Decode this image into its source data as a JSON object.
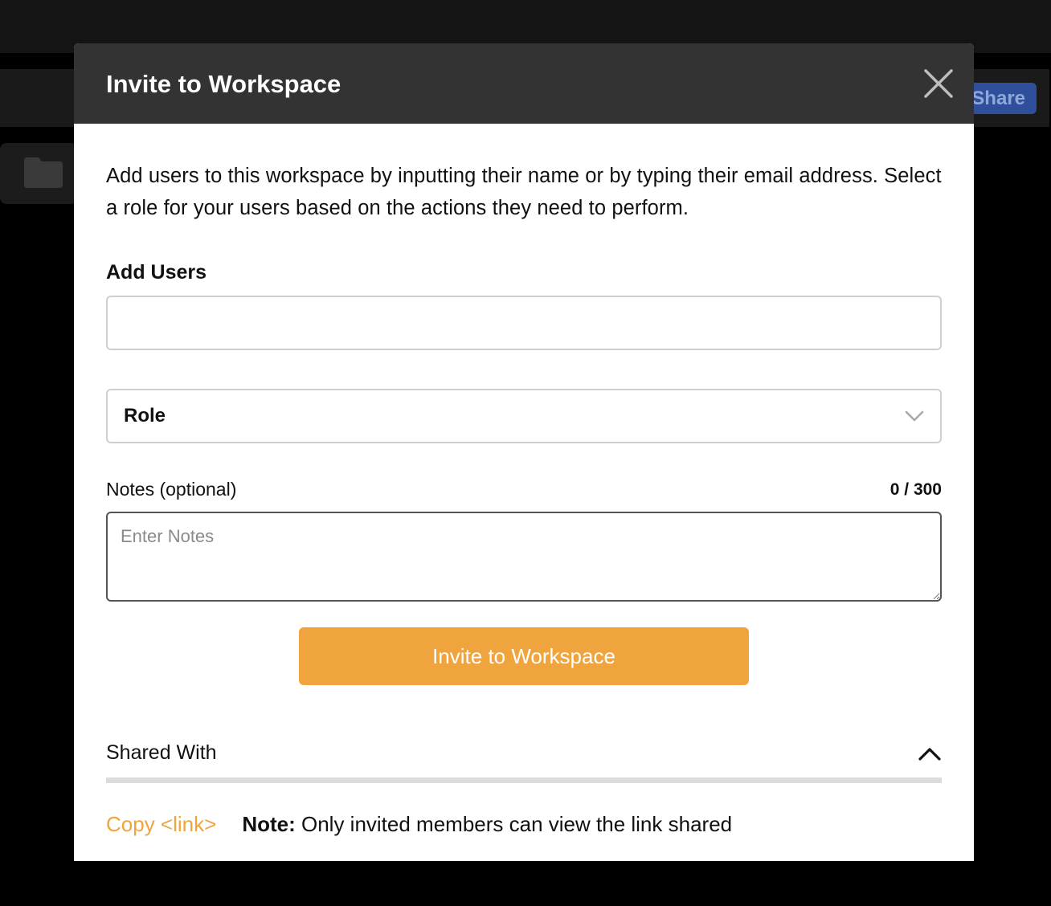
{
  "background": {
    "share_label": "Share"
  },
  "modal": {
    "title": "Invite to Workspace",
    "description": "Add users to this workspace by inputting their name or by typing their email address. Select a role for your users based on the actions they need to perform.",
    "add_users": {
      "label": "Add Users",
      "value": "",
      "placeholder": ""
    },
    "role": {
      "selected": "Role"
    },
    "notes": {
      "label": "Notes (optional)",
      "count": "0 / 300",
      "placeholder": "Enter Notes",
      "value": ""
    },
    "invite_button": "Invite to Workspace",
    "shared_with": {
      "label": "Shared With"
    },
    "footer": {
      "copy_link": "Copy <link>",
      "note_label": "Note:",
      "note_text": "Only invited members can view the link shared"
    }
  },
  "colors": {
    "accent": "#f0a43e",
    "header_bg": "#333333",
    "share_button": "#2f4f9a"
  },
  "icons": {
    "close": "close-icon",
    "role_dropdown": "chevron-down-icon",
    "shared_toggle": "chevron-up-icon",
    "folder": "folder-icon"
  }
}
